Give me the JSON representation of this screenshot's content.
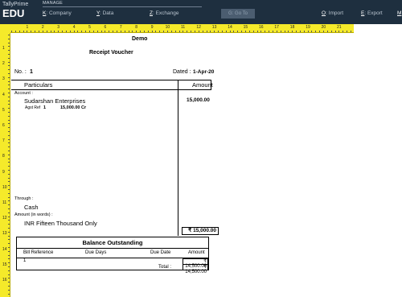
{
  "topbar": {
    "app_name": "TallyPrime",
    "edition": "EDU",
    "manage_label": "MANAGE",
    "company_key": "K",
    "company_label": ": Company",
    "data_key": "Y",
    "data_label": ": Data",
    "exchange_key": "Z",
    "exchange_label": ": Exchange",
    "goto_label": "G: Go To",
    "import_key": "O",
    "import_label": ": Import",
    "export_key": "E",
    "export_label": ": Export",
    "more_key": "M"
  },
  "ruler": {
    "horizontal": [
      "1",
      "2",
      "3",
      "4",
      "5",
      "6",
      "7",
      "8",
      "9",
      "10",
      "11",
      "12",
      "13",
      "14",
      "15",
      "16",
      "17",
      "18",
      "19",
      "20",
      "21"
    ],
    "vertical": [
      "1",
      "2",
      "3",
      "4",
      "5",
      "6",
      "7",
      "8",
      "9",
      "10",
      "11",
      "12",
      "13",
      "14",
      "15",
      "16"
    ]
  },
  "voucher": {
    "company": "Demo",
    "type": "Receipt Voucher",
    "no_label": "No. :",
    "no": "1",
    "dated_label": "Dated :",
    "dated": "1-Apr-20",
    "col_particulars": "Particulars",
    "col_amount": "Amount",
    "account_label": "Account :",
    "account_name": "Sudarshan Enterprises",
    "account_amount": "15,000.00",
    "ref_label": "Agst Ref",
    "ref_no": "1",
    "ref_amount": "15,000.00 Cr",
    "through_label": "Through :",
    "through_value": "Cash",
    "words_label": "Amount (in words) :",
    "words_value": "INR Fifteen Thousand Only",
    "total": "₹ 15,000.00"
  },
  "balance_outstanding": {
    "title": "Balance Outstanding",
    "col_bill_ref": "Bill Reference",
    "col_due_days": "Due Days",
    "col_due_date": "Due Date",
    "col_amount": "Amount",
    "row_ref": "1",
    "row_amount": "₹ 14,500.00",
    "total_label": "Total :",
    "total_amount": "₹ 14,500.00"
  }
}
